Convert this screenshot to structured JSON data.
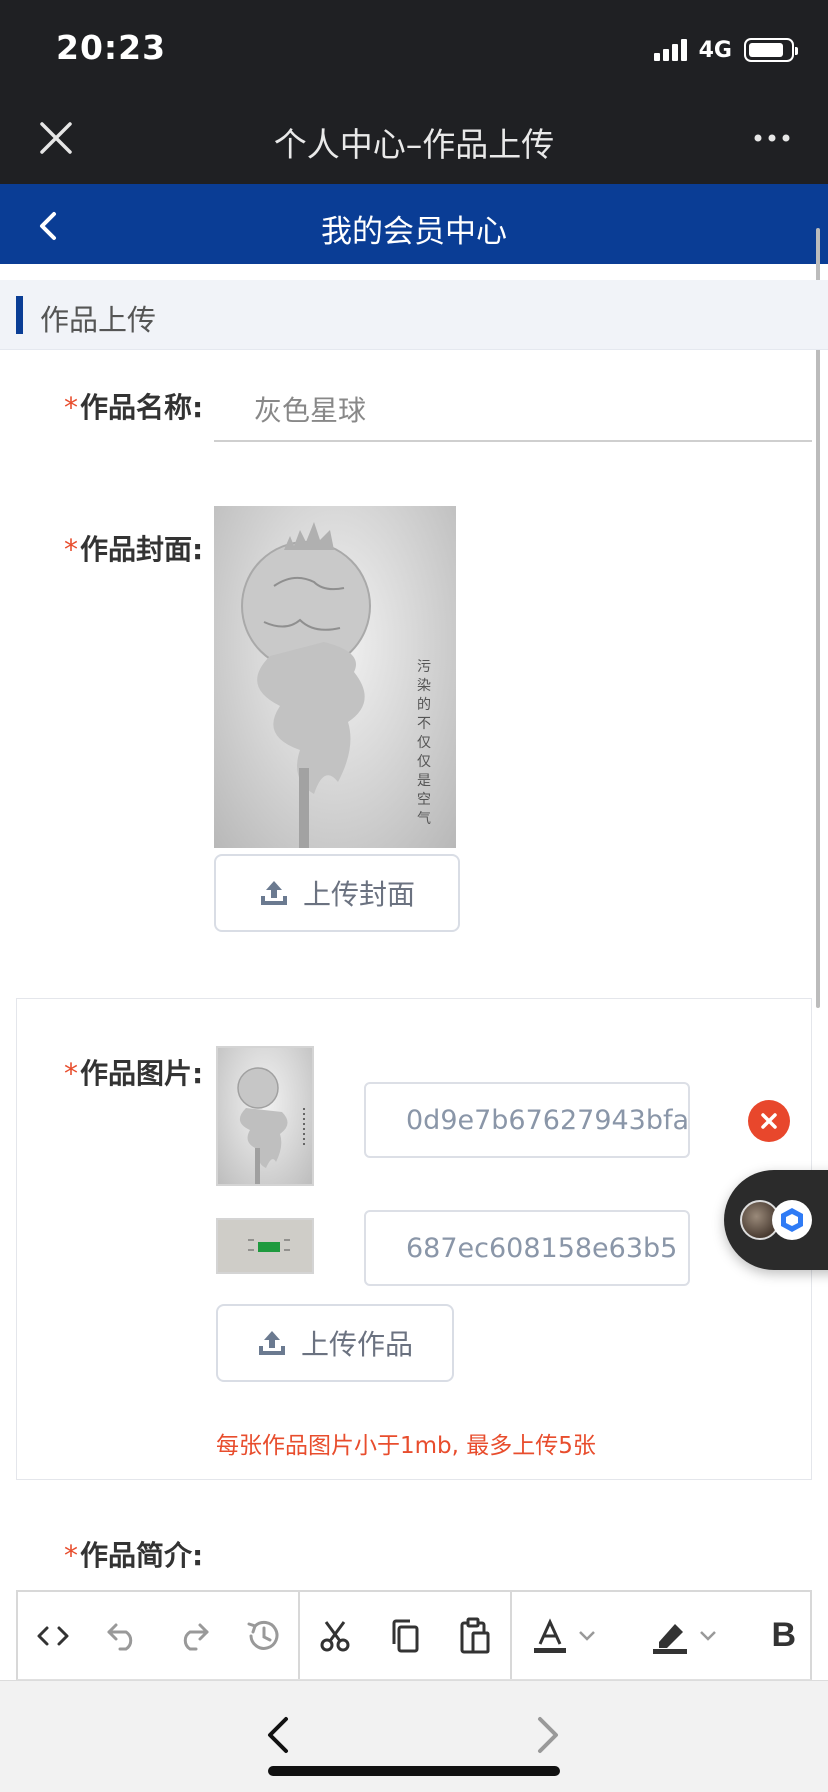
{
  "status_bar": {
    "time": "20:23",
    "network": "4G"
  },
  "wechat_header": {
    "title": "个人中心–作品上传"
  },
  "nav_bar": {
    "title": "我的会员中心"
  },
  "section": {
    "title": "作品上传"
  },
  "form": {
    "required_mark": "*",
    "name_label": "作品名称:",
    "name_value": "灰色星球",
    "cover_label": "作品封面:",
    "cover_caption": "污染的不仅仅是空气",
    "upload_cover_label": "上传封面",
    "images_label": "作品图片:",
    "image_files": [
      "0d9e7b67627943bfa",
      "687ec608158e63b5"
    ],
    "upload_work_label": "上传作品",
    "hint": "每张作品图片小于1mb, 最多上传5张",
    "intro_label": "作品简介:"
  },
  "colors": {
    "brand_blue": "#0a3d95",
    "danger": "#e84d2d"
  }
}
